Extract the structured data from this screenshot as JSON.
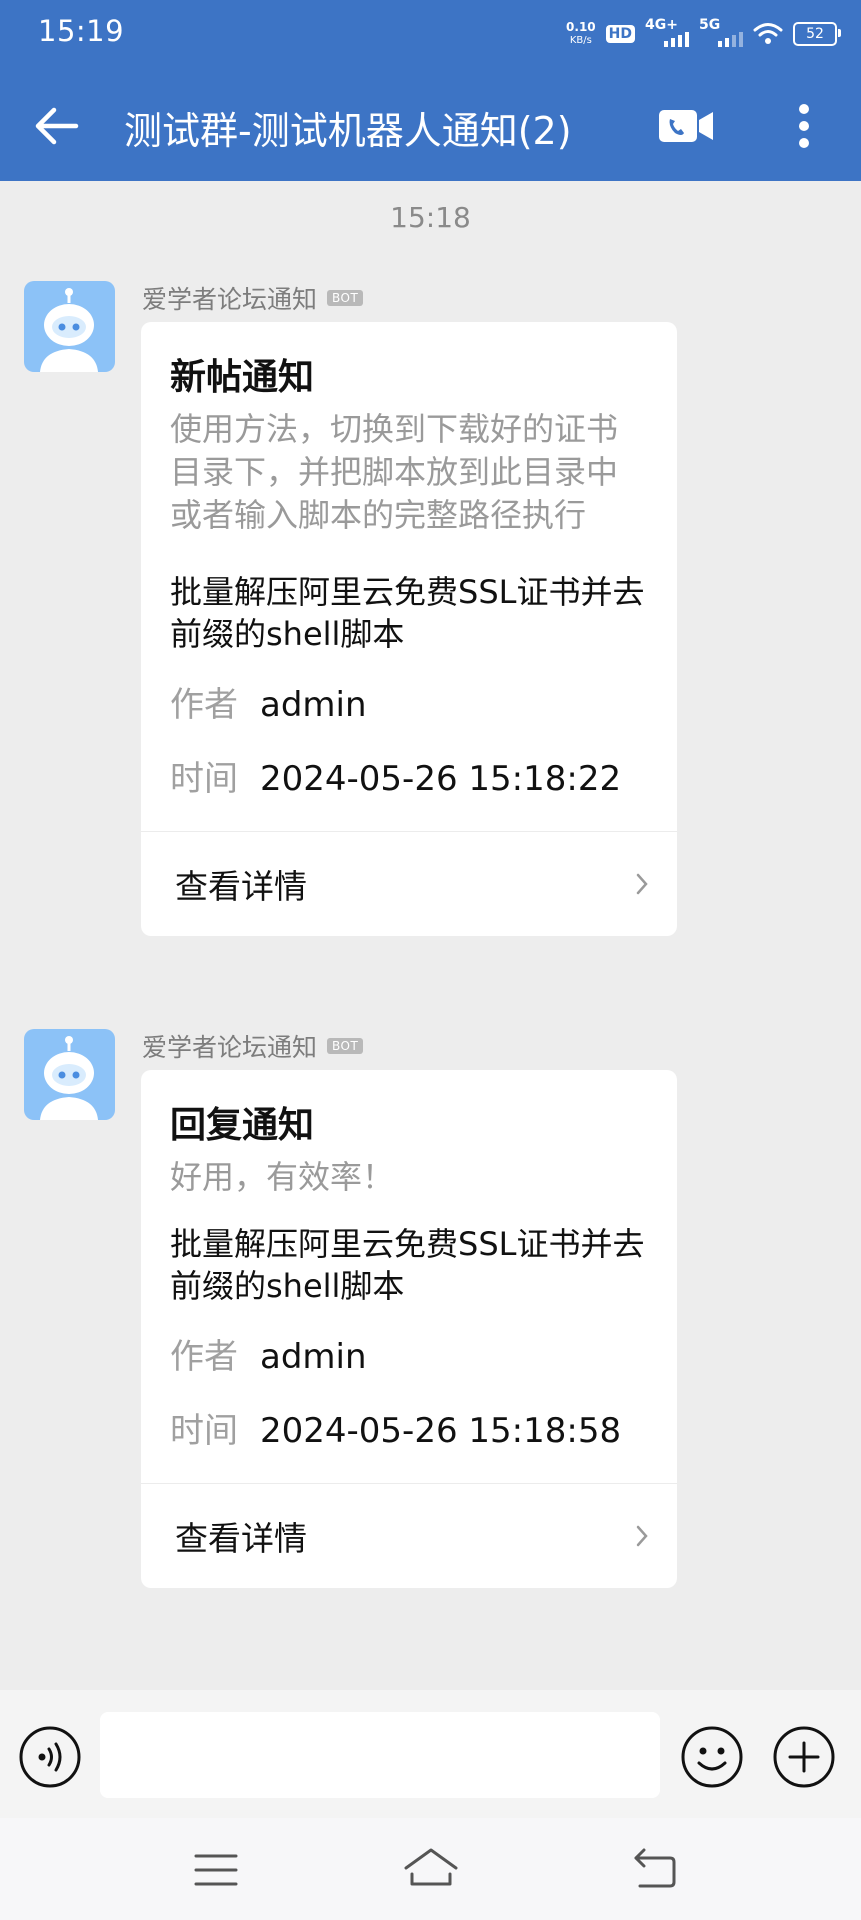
{
  "status_bar": {
    "time": "15:19",
    "net_speed_value": "0.10",
    "net_speed_unit": "KB/s",
    "hd_label": "HD",
    "network_1": "4G+",
    "network_2": "5G",
    "battery": "52"
  },
  "header": {
    "title": "测试群-测试机器人通知(2)"
  },
  "chat": {
    "time_divider": "15:18",
    "messages": [
      {
        "sender": "爱学者论坛通知",
        "badge": "BOT",
        "title": "新帖通知",
        "description": "使用方法，切换到下载好的证书目录下，并把脚本放到此目录中或者输入脚本的完整路径执行",
        "subject": "批量解压阿里云免费SSL证书并去前缀的shell脚本",
        "author_label": "作者",
        "author": "admin",
        "time_label": "时间",
        "time": "2024-05-26 15:18:22",
        "action": "查看详情"
      },
      {
        "sender": "爱学者论坛通知",
        "badge": "BOT",
        "title": "回复通知",
        "description": "好用，有效率！",
        "subject": "批量解压阿里云免费SSL证书并去前缀的shell脚本",
        "author_label": "作者",
        "author": "admin",
        "time_label": "时间",
        "time": "2024-05-26 15:18:58",
        "action": "查看详情"
      }
    ]
  },
  "input": {
    "value": "",
    "placeholder": ""
  },
  "icons": {
    "back": "arrow-left-icon",
    "video": "video-call-icon",
    "more": "more-vertical-icon",
    "voice": "voice-icon",
    "emoji": "emoji-icon",
    "add": "plus-icon",
    "nav_menu": "menu-icon",
    "nav_home": "home-icon",
    "nav_back": "back-icon"
  },
  "colors": {
    "header_bg": "#3d74c5",
    "chat_bg": "#ededed",
    "card_bg": "#ffffff",
    "avatar_bg": "#8cc2f7"
  }
}
